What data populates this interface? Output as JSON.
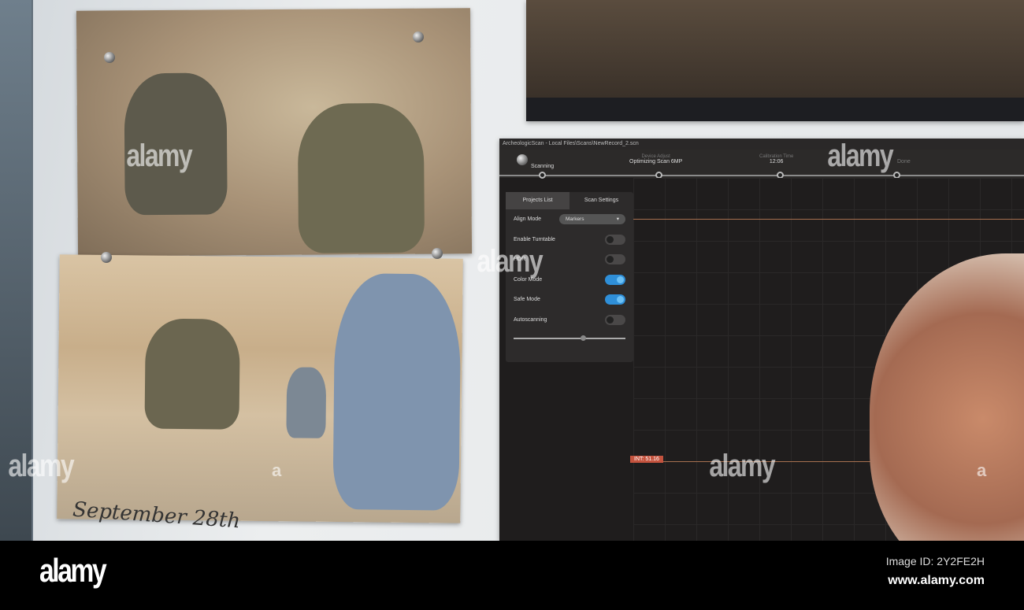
{
  "screen_ui": {
    "title": "ArcheologicScan - Local Files\\Scans\\NewRecord_2.scn",
    "timeline": [
      {
        "label": "Scanning",
        "sub": ""
      },
      {
        "label": "Optimizing Scan 6MP",
        "sub": "Device Adjust"
      },
      {
        "label": "12:06",
        "sub": "Calibration Time"
      },
      {
        "label": "Done",
        "sub": ""
      }
    ],
    "tabs": [
      "Projects List",
      "Scan Settings"
    ],
    "align_mode_label": "Align Mode",
    "align_mode_value": "Markers",
    "toggles": [
      {
        "label": "Enable Turntable",
        "on": false
      },
      {
        "label": "HDR",
        "on": false
      },
      {
        "label": "Color Mode",
        "on": true
      },
      {
        "label": "Safe Mode",
        "on": true
      },
      {
        "label": "Autoscanning",
        "on": false
      }
    ],
    "slider_value": 0.6,
    "int_label": "INT: 51.16",
    "accent": "#2f8fd8"
  },
  "handwriting": "September 28th",
  "watermark": {
    "brand": "alamy",
    "letter": "a",
    "image_id": "Image ID: 2Y2FE2H",
    "site": "www.alamy.com"
  }
}
